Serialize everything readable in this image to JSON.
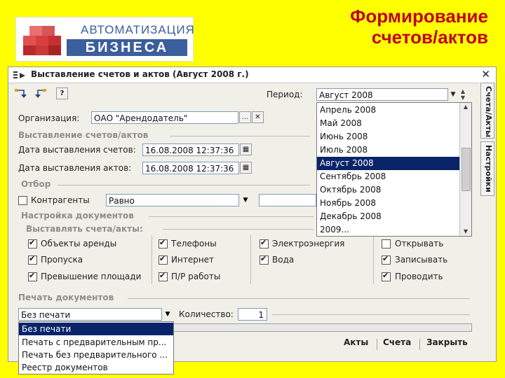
{
  "slide": {
    "title_line1": "Формирование",
    "title_line2": "счетов/актов",
    "logo_top": "АВТОМАТИЗАЦИЯ",
    "logo_bottom": "БИЗНЕСА",
    "title_color": "#c0001b",
    "background_color": "#ffff00"
  },
  "window": {
    "title": "Выставление счетов и актов (Август 2008 г.)",
    "close_icon": "close-icon",
    "toolbar": {
      "period_label": "Период:",
      "period_value": "Август 2008"
    },
    "org": {
      "label": "Организация:",
      "value": "ОАО \"Арендодатель\"",
      "select_label": "...",
      "clear_label": "✕"
    },
    "section_issue": "Выставление счетов/актов",
    "invoice_date": {
      "label": "Дата выставления счетов:",
      "value": "16.08.2008 12:37:36"
    },
    "act_date": {
      "label": "Дата выставления актов:",
      "value": "16.08.2008 12:37:36"
    },
    "section_filter": "Отбор",
    "filter": {
      "checkbox_label": "Контрагенты",
      "condition": "Равно"
    },
    "section_docs": "Настройка документов",
    "section_issue_invoices": "Выставлять счета/акты:",
    "checks_col1": [
      "Объекты аренды",
      "Пропуска",
      "Превышение площади"
    ],
    "checks_col2": [
      "Телефоны",
      "Интернет",
      "П/Р работы"
    ],
    "checks_col3": [
      "Электроэнергия",
      "Вода"
    ],
    "checks_col4": [
      "Открывать",
      "Записывать",
      "Проводить"
    ],
    "section_print": "Печать документов",
    "print": {
      "value": "Без печати",
      "qty_label": "Количество:",
      "qty_value": "1"
    },
    "print_options": [
      "Без печати",
      "Печать с предварительным пр...",
      "Печать без предварительного ...",
      "Реестр документов"
    ],
    "period_options": [
      "Апрель 2008",
      "Май 2008",
      "Июнь 2008",
      "Июль 2008",
      "Август 2008",
      "Сентябрь 2008",
      "Октябрь 2008",
      "Ноябрь 2008",
      "Декабрь 2008",
      "2009..."
    ],
    "tabs": [
      "Счета/Акты",
      "Настройки"
    ],
    "buttons": {
      "acts": "Акты",
      "invoices": "Счета",
      "close": "Закрыть"
    },
    "accent_color": "#0a246a"
  }
}
